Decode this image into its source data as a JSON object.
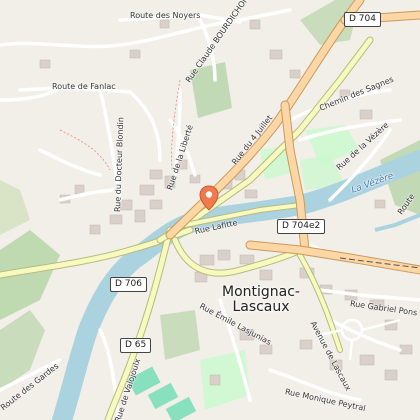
{
  "town": {
    "name_line1": "Montignac-",
    "name_line2": "Lascaux"
  },
  "shields": {
    "d704": "D 704",
    "d704e2": "D 704e2",
    "d706": "D 706",
    "d65": "D 65"
  },
  "streets": {
    "route_des_noyers": "Route des Noyers",
    "rue_claude_bourdichon": "Rue Claude BOURDICHON",
    "route_de_fanlac": "Route de Fanlac",
    "rue_du_docteur_blondin": "Rue du Docteur Blondin",
    "rue_de_la_liberte": "Rue de la Liberté",
    "rue_du_4_juillet": "Rue du 4 Juillet",
    "chemin_des_sagnes": "Chemin des Sagnes",
    "rue_de_la_vezere": "Rue de la Vézère",
    "rue_lafitte": "Rue Lafitte",
    "rue_emile_lasjunias": "Rue Émile Lasjunias",
    "avenue_de_lascaux": "Avenue de Lascaux",
    "rue_gabriel_pons": "Rue Gabriel Pons",
    "rue_monique_peytral": "Rue Monique Peytral",
    "rue_de_valojoulx": "Rue de Valojoulx",
    "route_des_gardes": "Route des Gardes",
    "route_partial": "Route"
  },
  "water": {
    "river_name": "La Vézère"
  },
  "colors": {
    "background": "#f2efe9",
    "water": "#aad3df",
    "primary_road": "#fcd6a4",
    "primary_casing": "#c99a5c",
    "secondary_road": "#f7fabf",
    "secondary_casing": "#b8ba7d",
    "forest": "#add19e",
    "park": "#c8facc",
    "building": "#d9d0c9",
    "pin": "#f07a4e"
  },
  "icons": {
    "marker": "location-pin-icon"
  }
}
